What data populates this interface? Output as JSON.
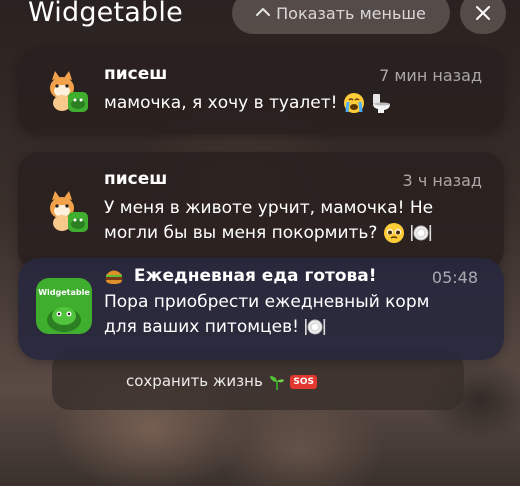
{
  "header": {
    "app_title": "Widgetable",
    "show_less_label": "Показать меньше",
    "close_icon": "close-icon"
  },
  "notifications": [
    {
      "name": "писеш",
      "time": "7 мин назад",
      "message_lines": [
        "мамочка, я хочу в туалет!"
      ],
      "emojis": [
        "crying-face",
        "toilet"
      ]
    },
    {
      "name": "писеш",
      "time": "3 ч назад",
      "message_lines": [
        "У меня в животе урчит, мамочка! Не",
        "могли бы вы меня покормить?"
      ],
      "emojis": [
        "pleading-face",
        "plate"
      ]
    },
    {
      "name": "Ежедневная еда готова!",
      "time": "05:48",
      "message_lines": [
        "Пора приобрести ежедневный корм",
        "для ваших питомцев!"
      ],
      "emojis": [
        "burger",
        "plate"
      ],
      "app_icon_text": "Widgetable"
    }
  ],
  "background_notification": {
    "text": "сохранить жизнь",
    "sos_label": "SOS"
  },
  "colors": {
    "card_bg": "#2a2220",
    "app_green": "#3fae2f"
  }
}
